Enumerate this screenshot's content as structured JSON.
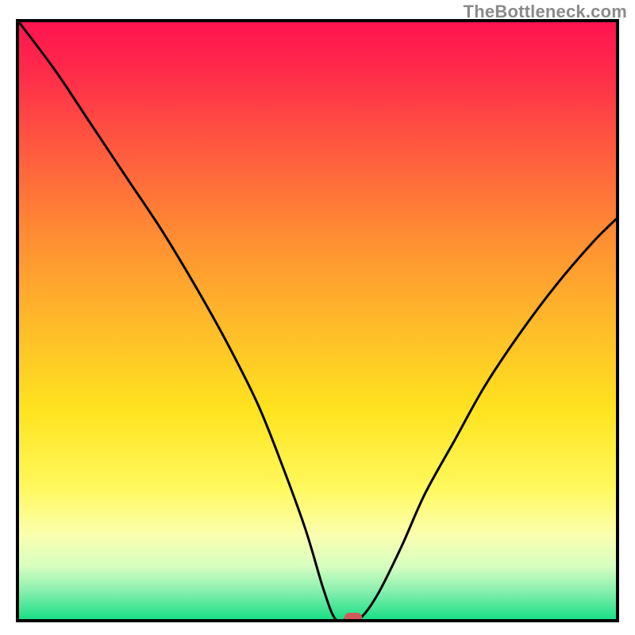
{
  "watermark": "TheBottleneck.com",
  "chart_data": {
    "type": "line",
    "title": "",
    "xlabel": "",
    "ylabel": "",
    "xlim": [
      0,
      100
    ],
    "ylim": [
      0,
      100
    ],
    "series": [
      {
        "name": "bottleneck-curve",
        "x": [
          0,
          6,
          12,
          18,
          24,
          30,
          35,
          40,
          44,
          48,
          51,
          53,
          55,
          57,
          60,
          64,
          68,
          73,
          78,
          84,
          90,
          96,
          100
        ],
        "y": [
          100,
          92,
          83,
          74,
          65,
          55,
          46,
          36,
          26,
          15,
          5,
          0,
          0,
          0,
          4,
          12,
          21,
          30,
          39,
          48,
          56,
          63,
          67
        ]
      }
    ],
    "marker": {
      "x": 56,
      "y": 0
    },
    "gradient_stops": [
      {
        "offset": 0.0,
        "color": "#ff1450"
      },
      {
        "offset": 0.08,
        "color": "#ff2a4a"
      },
      {
        "offset": 0.2,
        "color": "#ff5640"
      },
      {
        "offset": 0.35,
        "color": "#ff8a34"
      },
      {
        "offset": 0.5,
        "color": "#ffb92a"
      },
      {
        "offset": 0.65,
        "color": "#ffe31f"
      },
      {
        "offset": 0.78,
        "color": "#fff95e"
      },
      {
        "offset": 0.86,
        "color": "#fbffb0"
      },
      {
        "offset": 0.91,
        "color": "#d8ffc0"
      },
      {
        "offset": 0.95,
        "color": "#8ef0b0"
      },
      {
        "offset": 1.0,
        "color": "#1adf87"
      }
    ]
  }
}
